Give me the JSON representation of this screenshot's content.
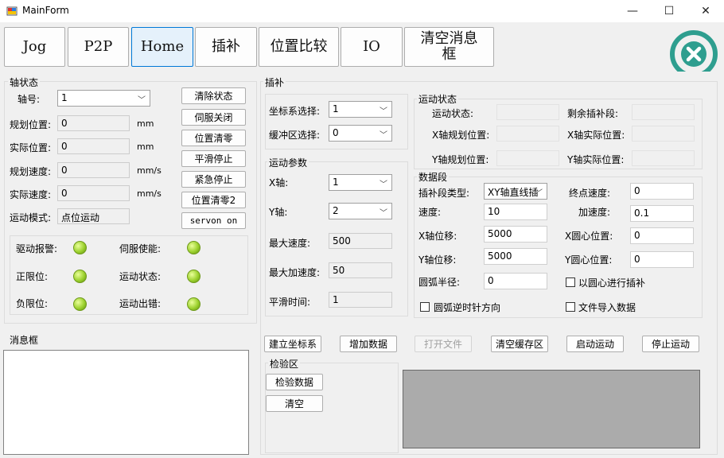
{
  "window": {
    "title": "MainForm",
    "minimize": "—",
    "maximize": "☐",
    "close": "✕"
  },
  "tabs": [
    "Jog",
    "P2P",
    "Home",
    "插补",
    "位置比较",
    "IO",
    "清空消息框"
  ],
  "axis_status": {
    "group_title": "轴状态",
    "axis_no_label": "轴号:",
    "axis_no_value": "1",
    "plan_pos_label": "规划位置:",
    "plan_pos_value": "0",
    "plan_pos_unit": "mm",
    "actual_pos_label": "实际位置:",
    "actual_pos_value": "0",
    "actual_pos_unit": "mm",
    "plan_vel_label": "规划速度:",
    "plan_vel_value": "0",
    "plan_vel_unit": "mm/s",
    "actual_vel_label": "实际速度:",
    "actual_vel_value": "0",
    "actual_vel_unit": "mm/s",
    "mode_label": "运动模式:",
    "mode_value": "点位运动",
    "buttons": [
      "清除状态",
      "伺服关闭",
      "位置清零",
      "平滑停止",
      "紧急停止",
      "位置清零2",
      "servon on"
    ],
    "indicators": {
      "drive_alarm": "驱动报警:",
      "servo_enable": "伺服使能:",
      "pos_limit": "正限位:",
      "motion_status": "运动状态:",
      "neg_limit": "负限位:",
      "motion_error": "运动出错:"
    }
  },
  "message_box": {
    "title": "消息框"
  },
  "interp": {
    "group_title": "插补",
    "coord_label": "坐标系选择:",
    "coord_value": "1",
    "buffer_label": "缓冲区选择:",
    "buffer_value": "0",
    "params": {
      "title": "运动参数",
      "x_axis_label": "X轴:",
      "x_axis_value": "1",
      "y_axis_label": "Y轴:",
      "y_axis_value": "2",
      "max_vel_label": "最大速度:",
      "max_vel_value": "500",
      "max_acc_label": "最大加速度:",
      "max_acc_value": "50",
      "smooth_label": "平滑时间:",
      "smooth_value": "1"
    },
    "run_status": {
      "title": "运动状态",
      "status_label": "运动状态:",
      "remaining_label": "剩余插补段:",
      "x_plan_label": "X轴规划位置:",
      "x_actual_label": "X轴实际位置:",
      "y_plan_label": "Y轴规划位置:",
      "y_actual_label": "Y轴实际位置:"
    },
    "segment": {
      "title": "数据段",
      "type_label": "插补段类型:",
      "type_value": "XY轴直线插",
      "end_vel_label": "终点速度:",
      "end_vel_value": "0",
      "vel_label": "速度:",
      "vel_value": "10",
      "acc_label": "加速度:",
      "acc_value": "0.1",
      "x_disp_label": "X轴位移:",
      "x_disp_value": "5000",
      "x_center_label": "X圆心位置:",
      "x_center_value": "0",
      "y_disp_label": "Y轴位移:",
      "y_disp_value": "5000",
      "y_center_label": "Y圆心位置:",
      "y_center_value": "0",
      "radius_label": "圆弧半径:",
      "radius_value": "0",
      "center_interp_label": "以圆心进行插补",
      "ccw_label": "圆弧逆时针方向",
      "file_import_label": "文件导入数据"
    },
    "actions": [
      "建立坐标系",
      "增加数据",
      "打开文件",
      "清空缓存区",
      "启动运动",
      "停止运动"
    ],
    "verify": {
      "title": "检验区",
      "check_button": "检验数据",
      "clear_button": "清空"
    }
  },
  "colors": {
    "accent": "#0078d7",
    "logo": "#2e9e8f",
    "led": "#9cd12e",
    "canvas": "#ababab"
  }
}
